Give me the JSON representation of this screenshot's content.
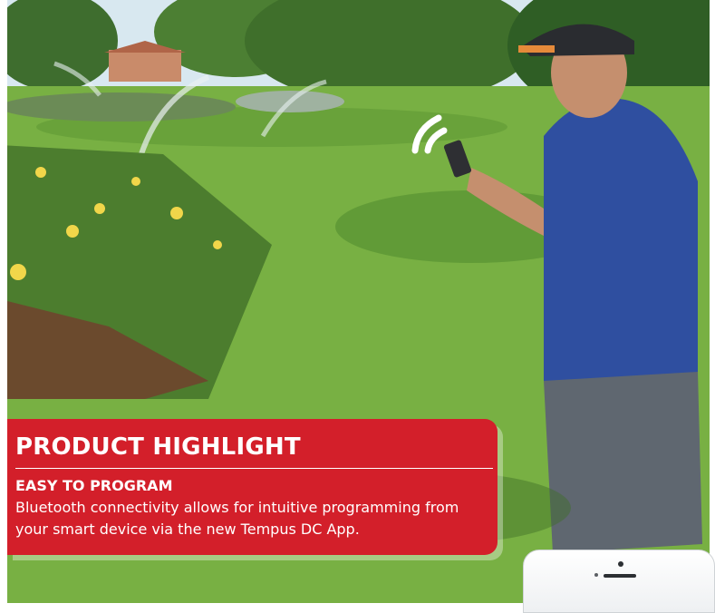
{
  "highlight": {
    "title": "PRODUCT HIGHLIGHT",
    "subtitle": "EASY TO PROGRAM",
    "body": "Bluetooth connectivity allows for intuitive programming from your smart device via the new Tempus DC App."
  },
  "icons": {
    "wireless_signal": "wifi-signal-icon",
    "phone": "smartphone-icon"
  },
  "colors": {
    "panel_red": "#d31f2a",
    "text_white": "#ffffff"
  }
}
